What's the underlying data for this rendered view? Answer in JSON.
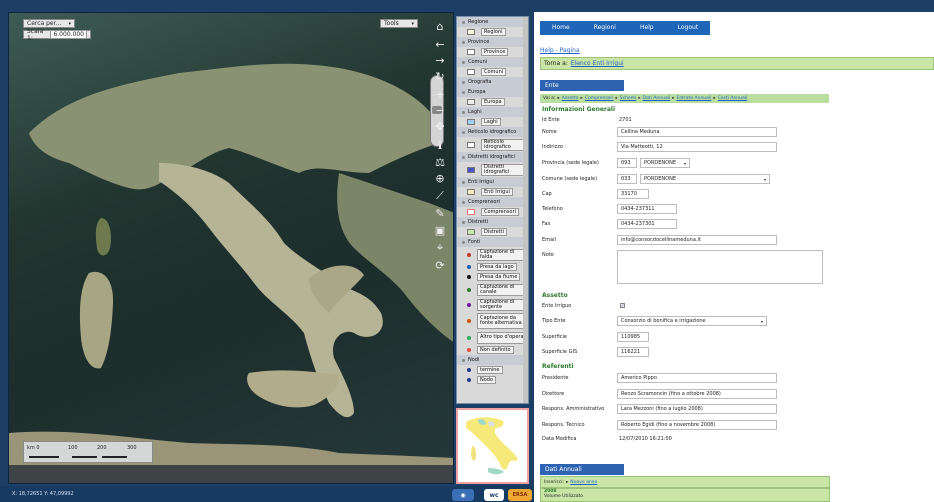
{
  "map": {
    "search_placeholder": "Cerca per...",
    "scale_label": "Scala 1:",
    "scale_value": "6.000.000",
    "tools_label": "Tools",
    "scalebar": {
      "km_label": "km 0",
      "ticks": [
        "100",
        "200",
        "300"
      ]
    }
  },
  "status_bar": {
    "coords": "X: 18,72651   Y: 47,09992"
  },
  "logos": {
    "wc": "wc",
    "sigla": "ERSA"
  },
  "toc": {
    "regione": "Regione",
    "regione_btn": "Regioni",
    "province": "Province",
    "province_btn": "Province",
    "comuni": "Comuni",
    "comuni_btn": "Comuni",
    "orografia": "Orografia",
    "europa": "Europa",
    "europa_btn": "Europa",
    "laghi": "Laghi",
    "laghi_btn": "Laghi",
    "reticolo": "Reticolo idrografico",
    "reticolo_btn": "Reticolo idrografico",
    "distretti_idro": "Distretti idrografici",
    "distretti_idro_btn": "Distretti idrografici",
    "enti": "Enti Irrigui",
    "enti_btn": "Enti Irrigui",
    "comprensori": "Comprensori",
    "comprensori_btn": "Comprensori",
    "distretti": "Distretti",
    "distretti_btn": "Distretti",
    "fonti": "Fonti",
    "fonti_items": [
      {
        "label": "Captazione di falda",
        "color": "#c0392b"
      },
      {
        "label": "Presa da lago",
        "color": "#1a5fb4"
      },
      {
        "label": "Presa da fiume",
        "color": "#111111"
      },
      {
        "label": "Captazione di canale",
        "color": "#2e7d32"
      },
      {
        "label": "Captazione di sorgente",
        "color": "#6a1b9a"
      },
      {
        "label": "Captazione da fonte alternativa",
        "color": "#d35400"
      },
      {
        "label": "Altro tipo d'opera",
        "color": "#27ae60"
      },
      {
        "label": "Non definito",
        "color": "#e74c3c"
      }
    ],
    "nodi": "Nodi",
    "nodi_items": [
      {
        "label": "termine"
      },
      {
        "label": "Nodo"
      }
    ]
  },
  "nav": {
    "home": "Home",
    "regioni": "Regioni",
    "help": "Help",
    "logout": "Logout"
  },
  "help_link": "Help - Pagina",
  "back": {
    "prefix": "Torna a:",
    "link": "Elenco Enti Irrigui"
  },
  "section": {
    "ente": "Ente",
    "dati_annuali": "Dati Annuali"
  },
  "crumb": [
    "Vai a:",
    "Assetto",
    "Comprensori",
    "Schemi",
    "Dati Annuali",
    "Entrate Annuali",
    "Costi Annuali"
  ],
  "info": {
    "title": "Informazioni Generali",
    "id_label": "Id Ente",
    "id_value": "2701",
    "nome_label": "Nome",
    "nome_value": "Cellina Meduna",
    "indirizzo_label": "Indirizzo",
    "indirizzo_value": "Via Matteotti, 12",
    "provincia_label": "Provincia (sede legale)",
    "provincia_code": "093",
    "provincia_value": "PORDENONE",
    "comune_label": "Comune (sede legale)",
    "comune_code": "033",
    "comune_value": "PORDENONE",
    "cap_label": "Cap",
    "cap_value": "33170",
    "telefono_label": "Telefono",
    "telefono_value": "0434-237311",
    "fax_label": "Fax",
    "fax_value": "0434-237301",
    "email_label": "Email",
    "email_value": "info@consorziocellinameduna.it",
    "note_label": "Note"
  },
  "assetto": {
    "title": "Assetto",
    "irriguo_label": "Ente Irriguo",
    "tipo_label": "Tipo Ente",
    "tipo_value": "Consorzio di bonifica e irrigazione",
    "superficie_label": "Superficie",
    "superficie_value": "110985",
    "superficie_gis_label": "Superficie GIS",
    "superficie_gis_value": "116221"
  },
  "referenti": {
    "title": "Referenti",
    "presidente_label": "Presidente",
    "presidente_value": "Americo Pippo",
    "direttore_label": "Direttore",
    "direttore_value": "Renzo Scramoncin (fino a ottobre 2008)",
    "amm_label": "Respons. Amministrativo",
    "amm_value": "Lara Mezzoni (fino a luglio 2008)",
    "tec_label": "Respons. Tecnico",
    "tec_value": "Roberto Egidi (fino a novembre 2008)",
    "modifica_label": "Data Modifica",
    "modifica_value": "12/07/2010 16:21:00"
  },
  "annual": {
    "inserisci": "Inserisci:",
    "nuovo_anno": "Nuovo anno",
    "anno": "2008",
    "volume": "Volume Utilizzato"
  },
  "colors": {
    "nav_bg": "#1e64b8",
    "green_bar": "#c9e6a6",
    "section_green": "#2d7a2d",
    "dark_frame": "#1d3f66"
  }
}
